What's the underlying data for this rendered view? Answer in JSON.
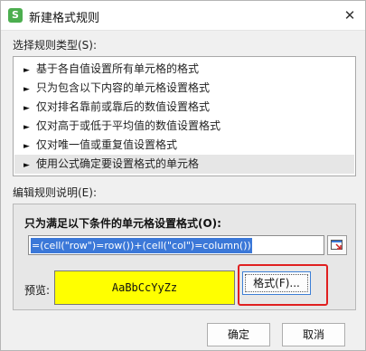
{
  "window": {
    "title": "新建格式规则",
    "app_icon_letter": "S",
    "close_glyph": "✕"
  },
  "rule_type": {
    "label": "选择规则类型(S):",
    "items": [
      "基于各自值设置所有单元格的格式",
      "只为包含以下内容的单元格设置格式",
      "仅对排名靠前或靠后的数值设置格式",
      "仅对高于或低于平均值的数值设置格式",
      "仅对唯一值或重复值设置格式",
      "使用公式确定要设置格式的单元格"
    ],
    "selected_index": 5,
    "arrow": "►"
  },
  "description": {
    "label": "编辑规则说明(E):",
    "heading": "只为满足以下条件的单元格设置格式(O):",
    "formula": "=(cell(\"row\")=row())+(cell(\"col\")=column())",
    "preview_label": "预览:",
    "preview_sample": "AaBbCcYyZz",
    "preview_color": "#ffff00",
    "format_button": "格式(F)..."
  },
  "buttons": {
    "ok": "确定",
    "cancel": "取消"
  },
  "colors": {
    "selection": "#3b78d8",
    "highlight": "#e02020"
  }
}
